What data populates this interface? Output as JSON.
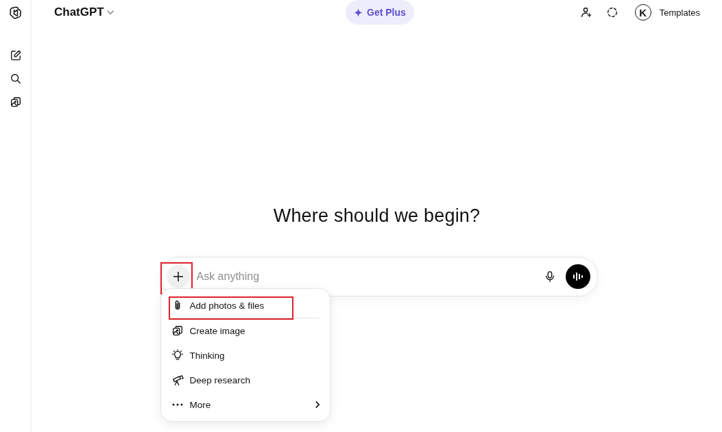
{
  "sidebar": {
    "items": [
      {
        "kind": "new-chat"
      },
      {
        "kind": "search"
      },
      {
        "kind": "images"
      }
    ]
  },
  "header": {
    "model": "ChatGPT",
    "upgrade": "Get Plus",
    "avatar_letter": "K",
    "account": "Templates"
  },
  "heading": "Where should we begin?",
  "composer": {
    "placeholder": "Ask anything",
    "plus_highlighted": true
  },
  "menu": {
    "items": [
      {
        "kind": "attach",
        "label": "Add photos & files",
        "highlighted": true
      },
      {
        "kind": "divider"
      },
      {
        "kind": "image",
        "label": "Create image",
        "highlighted": false
      },
      {
        "kind": "thinking",
        "label": "Thinking",
        "highlighted": false
      },
      {
        "kind": "research",
        "label": "Deep research",
        "highlighted": false
      },
      {
        "kind": "more",
        "label": "More",
        "highlighted": false
      }
    ]
  }
}
